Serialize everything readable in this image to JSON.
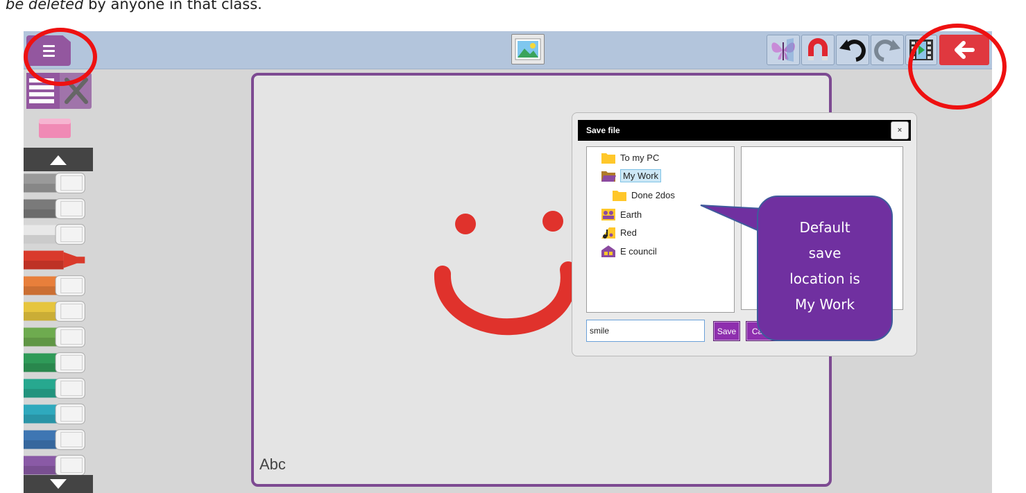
{
  "document": {
    "caption_italic": "be deleted",
    "caption_rest": " by anyone in that class."
  },
  "toolbar": {
    "menu_icon": "hamburger-icon",
    "image_icon": "picture-icon",
    "tools": [
      "butterfly-icon",
      "magnet-icon",
      "undo-icon",
      "redo-icon",
      "film-icon"
    ],
    "back_icon": "back-arrow-icon"
  },
  "sidebar": {
    "mode_icon": "pens-and-tools-icon",
    "eraser_icon": "eraser-icon",
    "up_icon": "triangle-up-icon",
    "down_icon": "triangle-down-icon",
    "pen_colors": [
      "#9a9a9a",
      "#7a7a7a",
      "#d8d8d8",
      "#d93a2b",
      "#e87f3b",
      "#e6c53e",
      "#6eab4f",
      "#2f9a58",
      "#27a88f",
      "#2fa9bd",
      "#3e76b3",
      "#8a5aa6"
    ],
    "selected_pen": 3
  },
  "canvas": {
    "label": "Abc",
    "drawing": "red smiley face",
    "stroke_color": "#e0322c"
  },
  "dialog": {
    "title": "Save file",
    "close_label": "×",
    "folders": [
      {
        "label": "To my PC",
        "icon": "folder-icon"
      },
      {
        "label": "My Work",
        "icon": "open-folder-icon"
      },
      {
        "label": "Done 2dos",
        "icon": "folder-icon"
      },
      {
        "label": "Earth",
        "icon": "group-icon"
      },
      {
        "label": "Red",
        "icon": "music-notes-icon"
      },
      {
        "label": "E council",
        "icon": "house-icon"
      }
    ],
    "selected_folder": "My Work",
    "filename_value": "smile",
    "save_label": "Save",
    "cancel_label": "Cancel"
  },
  "callout": {
    "text_lines": [
      "Default",
      "save",
      "location is",
      "My Work"
    ]
  },
  "colors": {
    "accent_purple": "#93579f",
    "back_red": "#e0383f",
    "topbar": "#b3c5dc",
    "highlight_circle": "#ee1111",
    "callout_fill": "#7030a0"
  }
}
